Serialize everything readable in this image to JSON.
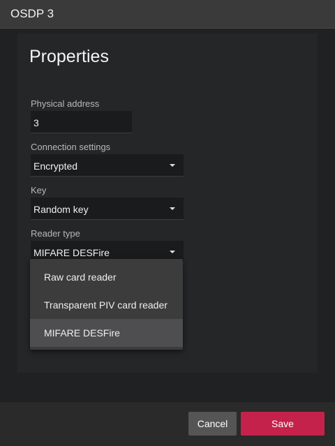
{
  "window": {
    "title": "OSDP 3"
  },
  "panel": {
    "title": "Properties"
  },
  "fields": {
    "physical_address": {
      "label": "Physical address",
      "value": "3"
    },
    "connection_settings": {
      "label": "Connection settings",
      "value": "Encrypted"
    },
    "key": {
      "label": "Key",
      "value": "Random key"
    },
    "reader_type": {
      "label": "Reader type",
      "value": "MIFARE DESFire"
    }
  },
  "reader_type_options": [
    {
      "label": "Raw card reader",
      "selected": false
    },
    {
      "label": "Transparent PIV card reader",
      "selected": false
    },
    {
      "label": "MIFARE DESFire",
      "selected": true
    }
  ],
  "footer": {
    "cancel_label": "Cancel",
    "save_label": "Save"
  },
  "colors": {
    "accent": "#c4224a",
    "background": "#202122",
    "panel": "#252628"
  },
  "icons": {
    "dropdown": "caret-down-icon"
  }
}
